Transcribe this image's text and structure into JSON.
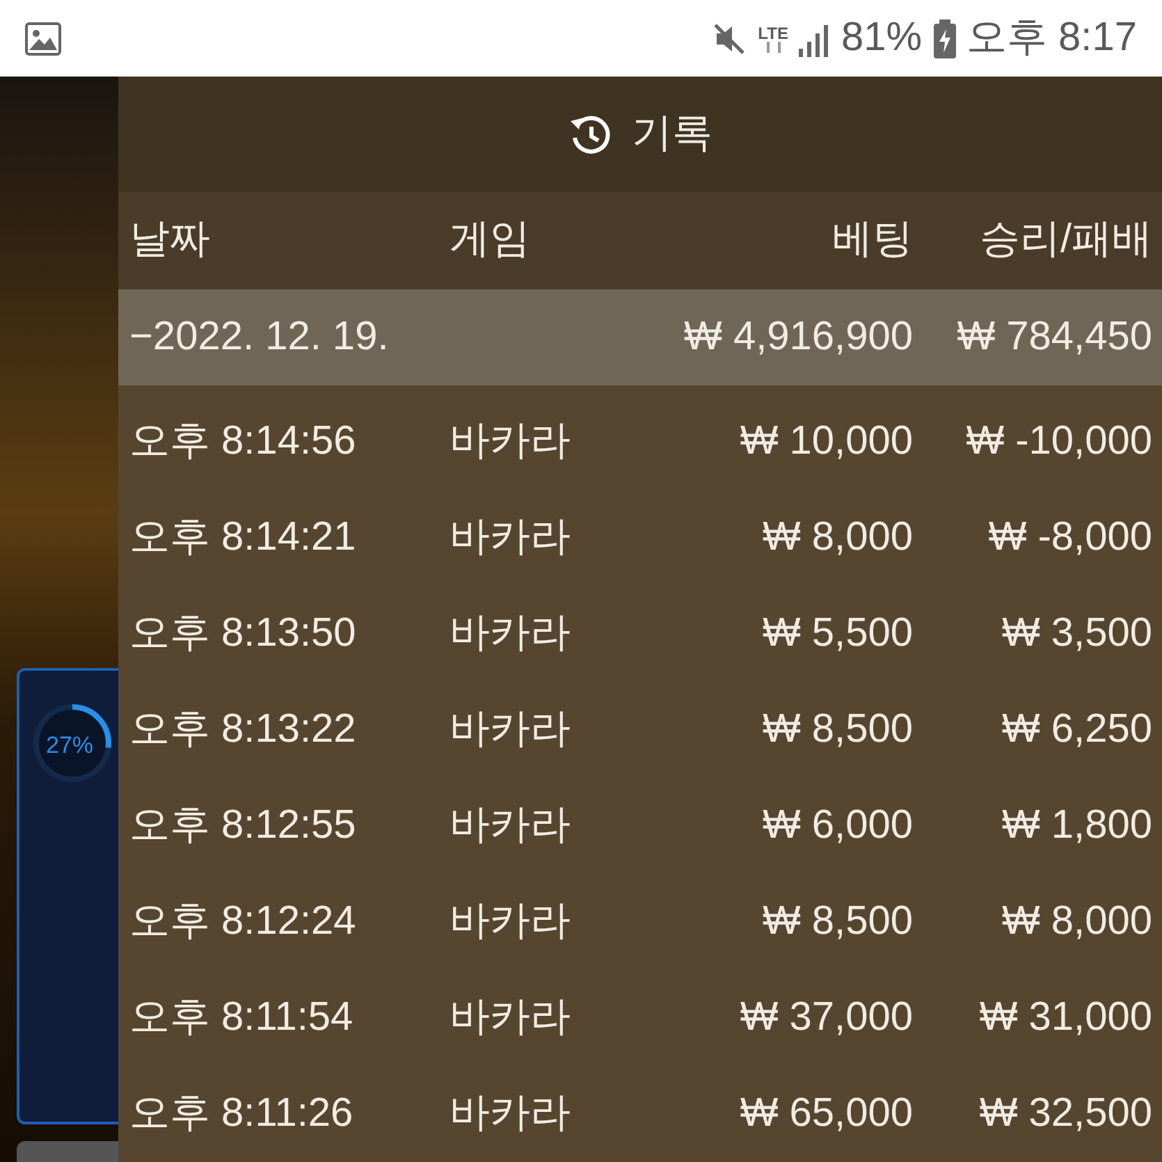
{
  "status_bar": {
    "network": "LTE",
    "battery": "81%",
    "time": "오후 8:17"
  },
  "background": {
    "progress_card": {
      "reading": "27%",
      "level": 0.27
    }
  },
  "panel": {
    "title": "기록",
    "columns": [
      "날짜",
      "게임",
      "베팅",
      "승리/패배"
    ],
    "group": {
      "date": "−2022. 12. 19.",
      "bet": "₩ 4,916,900",
      "result": "₩ 784,450",
      "expanded": true
    },
    "rows": [
      {
        "time": "오후 8:14:56",
        "game": "바카라",
        "bet": "₩ 10,000",
        "result": "₩ -10,000"
      },
      {
        "time": "오후 8:14:21",
        "game": "바카라",
        "bet": "₩ 8,000",
        "result": "₩ -8,000"
      },
      {
        "time": "오후 8:13:50",
        "game": "바카라",
        "bet": "₩ 5,500",
        "result": "₩ 3,500"
      },
      {
        "time": "오후 8:13:22",
        "game": "바카라",
        "bet": "₩ 8,500",
        "result": "₩ 6,250"
      },
      {
        "time": "오후 8:12:55",
        "game": "바카라",
        "bet": "₩ 6,000",
        "result": "₩ 1,800"
      },
      {
        "time": "오후 8:12:24",
        "game": "바카라",
        "bet": "₩ 8,500",
        "result": "₩ 8,000"
      },
      {
        "time": "오후 8:11:54",
        "game": "바카라",
        "bet": "₩ 37,000",
        "result": "₩ 31,000"
      },
      {
        "time": "오후 8:11:26",
        "game": "바카라",
        "bet": "₩ 65,000",
        "result": "₩ 32,500"
      }
    ]
  }
}
